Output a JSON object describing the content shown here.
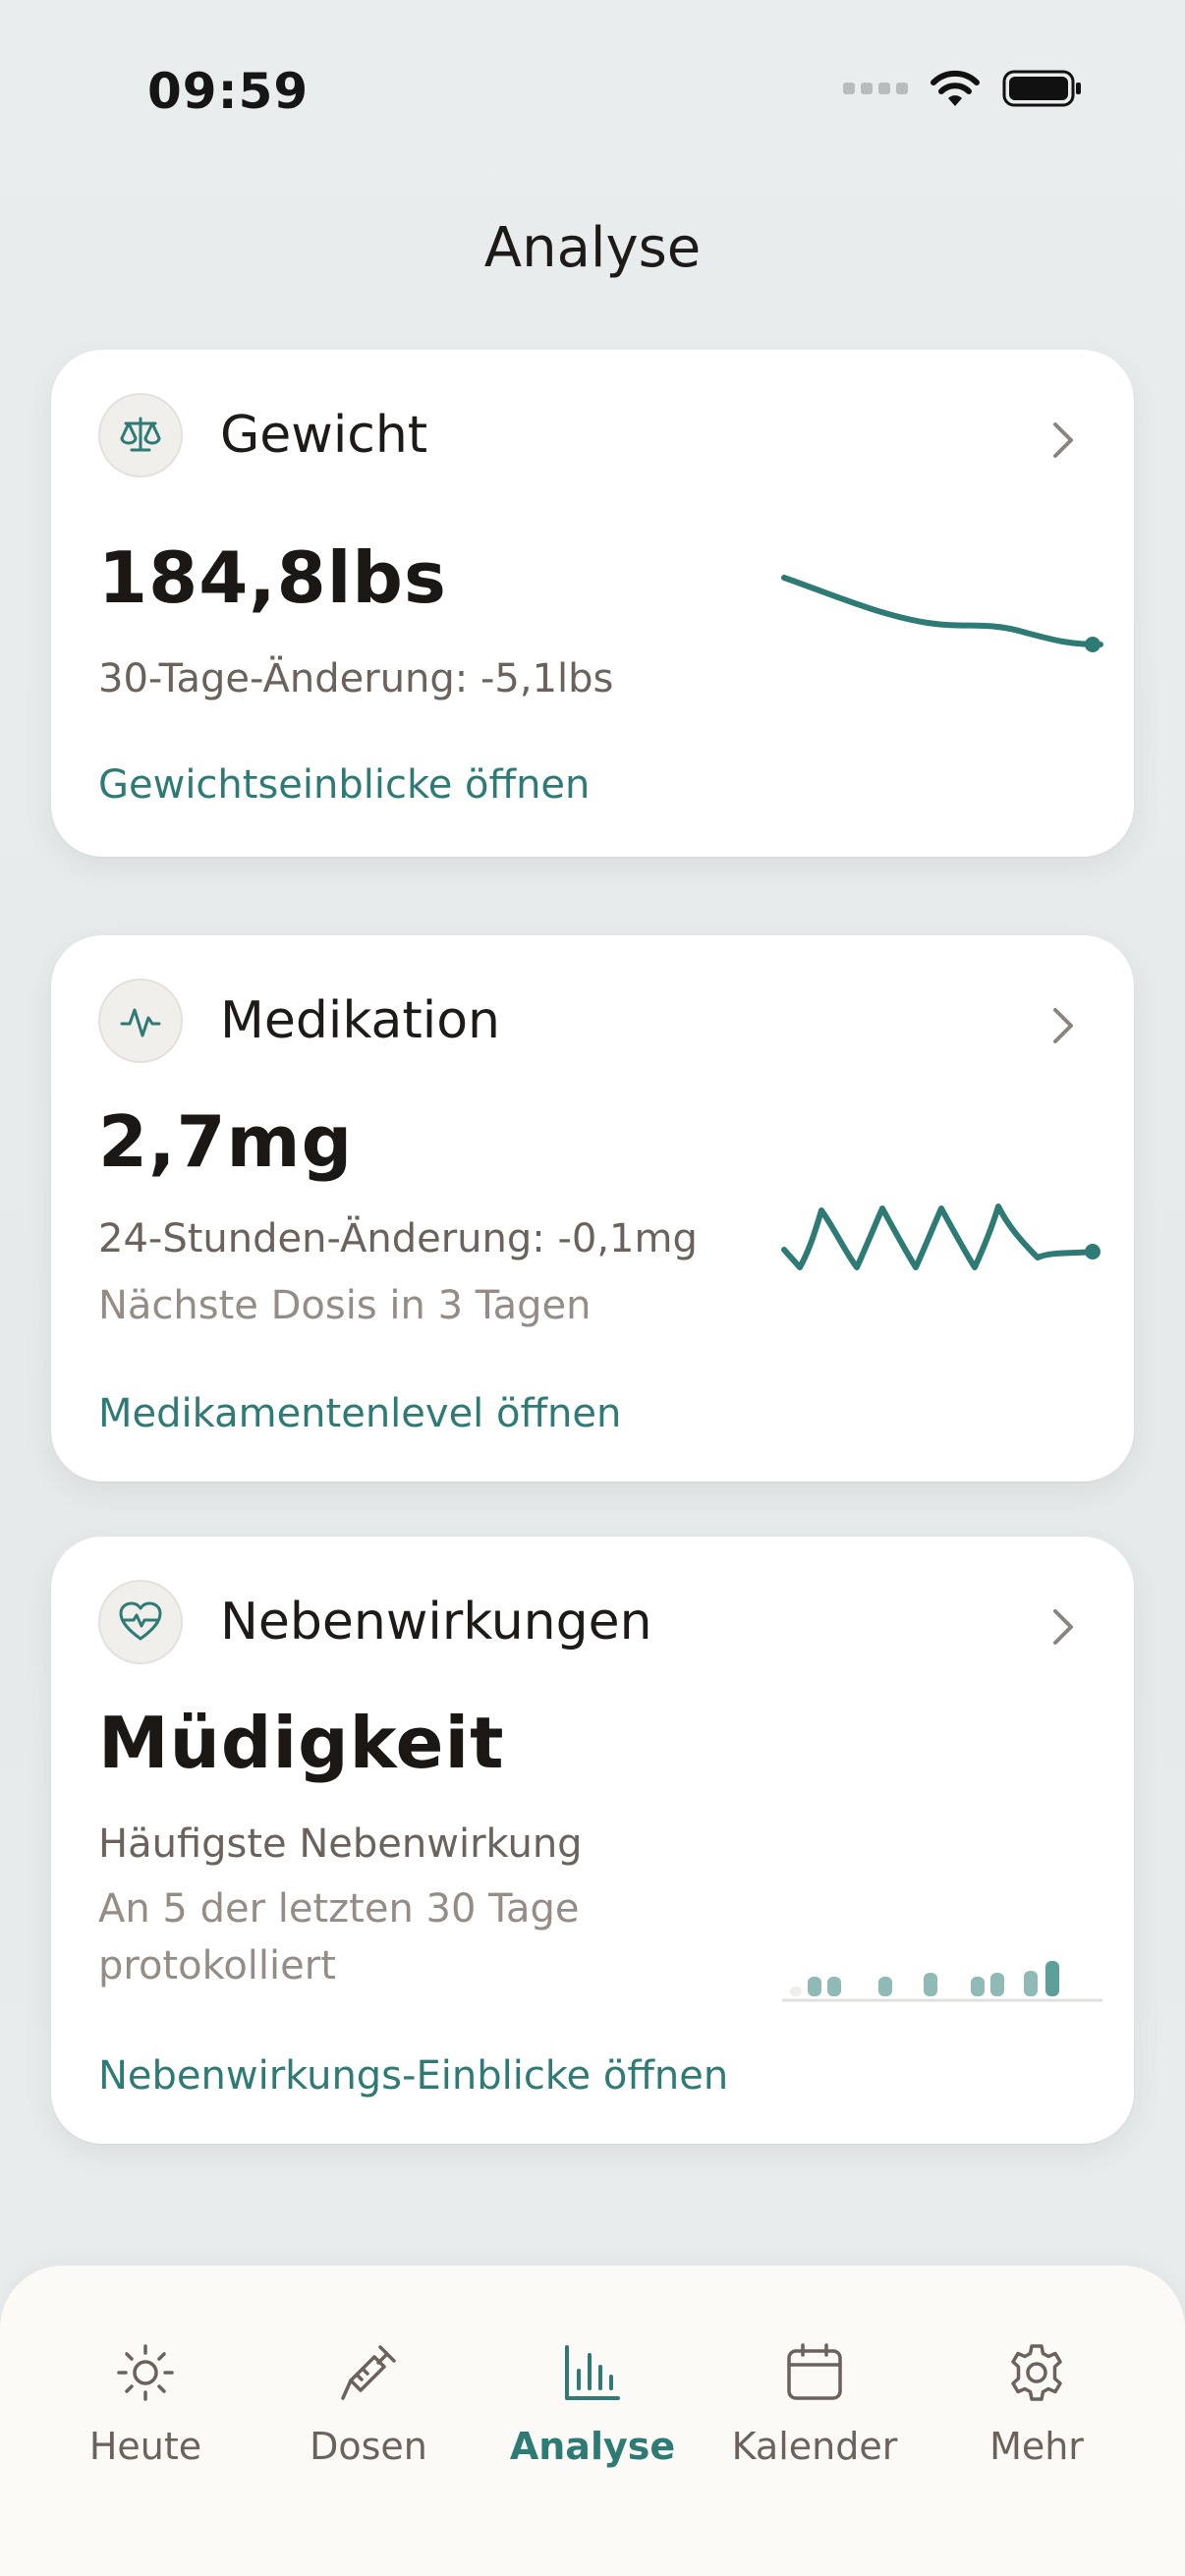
{
  "status_bar": {
    "time": "09:59"
  },
  "header": {
    "title": "Analyse"
  },
  "cards": [
    {
      "title": "Gewicht",
      "icon": "scale-icon",
      "value": "184,8lbs",
      "line1": "30-Tage-Änderung: -5,1lbs",
      "link": "Gewichtseinblicke öffnen"
    },
    {
      "title": "Medikation",
      "icon": "pulse-icon",
      "value": "2,7mg",
      "line1": "24-Stunden-Änderung: -0,1mg",
      "line2": "Nächste Dosis in 3 Tagen",
      "link": "Medikamentenlevel öffnen"
    },
    {
      "title": "Nebenwirkungen",
      "icon": "heart-pulse-icon",
      "value": "Müdigkeit",
      "line1": "Häufigste Nebenwirkung",
      "line2": "An 5 der letzten 30 Tage",
      "line3": "protokolliert",
      "link": "Nebenwirkungs-Einblicke öffnen"
    }
  ],
  "tabs": [
    {
      "label": "Heute",
      "icon": "sun-icon",
      "active": false
    },
    {
      "label": "Dosen",
      "icon": "syringe-icon",
      "active": false
    },
    {
      "label": "Analyse",
      "icon": "bar-chart-icon",
      "active": true
    },
    {
      "label": "Kalender",
      "icon": "calendar-icon",
      "active": false
    },
    {
      "label": "Mehr",
      "icon": "gear-icon",
      "active": false
    }
  ],
  "colors": {
    "accent": "#2e7a75",
    "text": "#1d1a17",
    "muted": "#6a625b",
    "background": "#e8ecec"
  }
}
